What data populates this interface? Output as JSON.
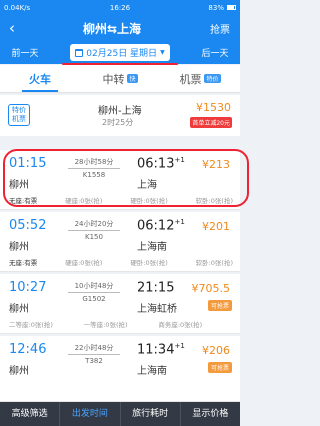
{
  "status": {
    "left": "0.04K/s",
    "time": "16:26",
    "battery": "83%"
  },
  "header": {
    "title": "柳州⇆上海",
    "grab": "抢票"
  },
  "datebar": {
    "prev": "前一天",
    "date": "02月25日 星期日",
    "next": "后一天"
  },
  "tabs": [
    {
      "label": "火车"
    },
    {
      "label": "中转",
      "badge": "快"
    },
    {
      "label": "机票",
      "badge": "特价"
    }
  ],
  "promo": {
    "tag": "特价机票",
    "route": "柳州-上海",
    "duration": "2时25分",
    "price": "¥1530",
    "badge": "首单立减20元"
  },
  "trains": [
    {
      "dep": "01:15",
      "arr": "06:13",
      "plus": "+1",
      "duration": "28小时58分",
      "train": "K1558",
      "from": "柳州",
      "to": "上海",
      "price": "¥213",
      "avail": "",
      "seats": [
        "无座:有票",
        "硬座:0张(抢)",
        "硬卧:0张(抢)",
        "软卧:0张(抢)"
      ]
    },
    {
      "dep": "05:52",
      "arr": "06:12",
      "plus": "+1",
      "duration": "24小时20分",
      "train": "K150",
      "from": "柳州",
      "to": "上海南",
      "price": "¥201",
      "avail": "",
      "seats": [
        "无座:有票",
        "硬座:0张(抢)",
        "硬卧:0张(抢)",
        "软卧:0张(抢)"
      ]
    },
    {
      "dep": "10:27",
      "arr": "21:15",
      "plus": "",
      "duration": "10小时48分",
      "train": "G1502",
      "from": "柳州",
      "to": "上海虹桥",
      "price": "¥705.5",
      "avail": "可抢票",
      "seats": [
        "二等座:0张(抢)",
        "一等座:0张(抢)",
        "商务座:0张(抢)",
        ""
      ]
    },
    {
      "dep": "12:46",
      "arr": "11:34",
      "plus": "+1",
      "duration": "22小时48分",
      "train": "T382",
      "from": "柳州",
      "to": "上海南",
      "price": "¥206",
      "avail": "可抢票",
      "seats": [
        "",
        "",
        "",
        ""
      ]
    }
  ],
  "bottom": [
    "高级筛选",
    "出发时间",
    "旅行耗时",
    "显示价格"
  ]
}
